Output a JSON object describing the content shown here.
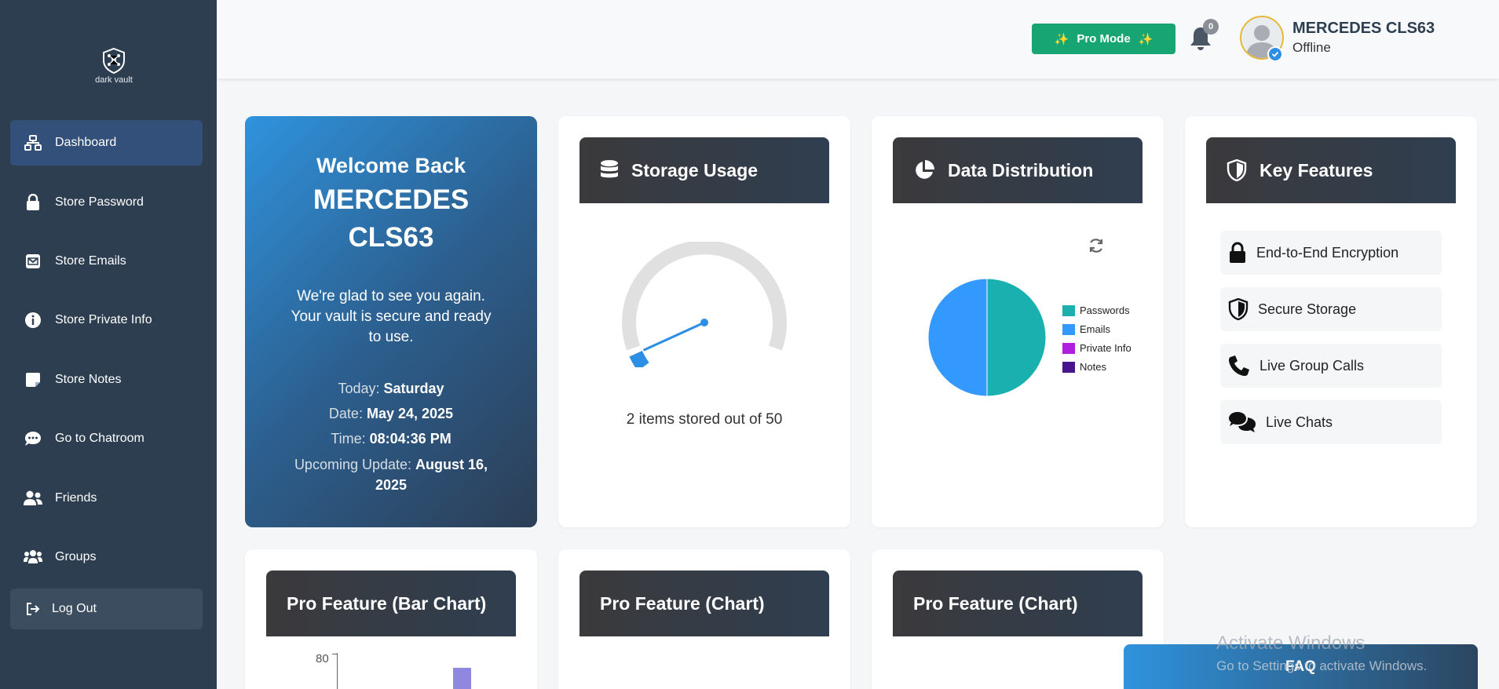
{
  "sidebar": {
    "logo_text": "dark vault",
    "items": [
      {
        "label": "Dashboard"
      },
      {
        "label": "Store Password"
      },
      {
        "label": "Store Emails"
      },
      {
        "label": "Store Private Info"
      },
      {
        "label": "Store Notes"
      },
      {
        "label": "Go to Chatroom"
      },
      {
        "label": "Friends"
      },
      {
        "label": "Groups"
      }
    ],
    "logout_label": "Log Out"
  },
  "header": {
    "pro_button_label": "Pro Mode",
    "notification_count": "0",
    "user_name": "MERCEDES CLS63",
    "user_status": "Offline"
  },
  "welcome": {
    "greeting": "Welcome Back",
    "name": "MERCEDES CLS63",
    "message": "We're glad to see you again. Your vault is secure and ready to use.",
    "today_label": "Today:",
    "today_value": "Saturday",
    "date_label": "Date:",
    "date_value": "May 24, 2025",
    "time_label": "Time:",
    "time_value": "08:04:36 PM",
    "update_label": "Upcoming Update:",
    "update_value": "August 16, 2025"
  },
  "storage": {
    "title": "Storage Usage",
    "stored": 2,
    "capacity": 50,
    "summary": "2 items stored out of 50"
  },
  "distribution": {
    "title": "Data Distribution",
    "legend": [
      {
        "label": "Passwords",
        "color": "#1ab0b0"
      },
      {
        "label": "Emails",
        "color": "#3399ff"
      },
      {
        "label": "Private Info",
        "color": "#b01ee0"
      },
      {
        "label": "Notes",
        "color": "#4a148c"
      }
    ]
  },
  "features": {
    "title": "Key Features",
    "items": [
      {
        "label": "End-to-End Encryption"
      },
      {
        "label": "Secure Storage"
      },
      {
        "label": "Live Group Calls"
      },
      {
        "label": "Live Chats"
      }
    ]
  },
  "pro_cards": [
    {
      "title": "Pro Feature (Bar Chart)"
    },
    {
      "title": "Pro Feature (Chart)"
    },
    {
      "title": "Pro Feature (Chart)"
    }
  ],
  "chart_data": {
    "type": "pie",
    "categories": [
      "Passwords",
      "Emails",
      "Private Info",
      "Notes"
    ],
    "values": [
      1,
      1,
      0,
      0
    ],
    "colors": [
      "#1ab0b0",
      "#3399ff",
      "#b01ee0",
      "#4a148c"
    ],
    "legend": "right"
  },
  "bar_preview": {
    "y_tick": "80",
    "bar_color": "#9088e0"
  },
  "faq_label": "FAQ",
  "watermark": {
    "line1": "Activate Windows",
    "line2": "Go to Settings to activate Windows."
  }
}
